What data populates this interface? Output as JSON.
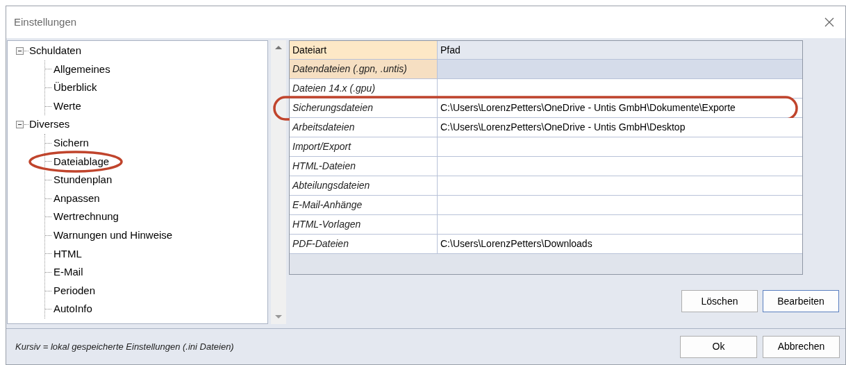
{
  "window": {
    "title": "Einstellungen"
  },
  "tree": [
    {
      "label": "Schuldaten",
      "expanded": true,
      "children": [
        {
          "label": "Allgemeines",
          "circled": false
        },
        {
          "label": "Überblick",
          "circled": false
        },
        {
          "label": "Werte",
          "circled": false
        }
      ]
    },
    {
      "label": "Diverses",
      "expanded": true,
      "children": [
        {
          "label": "Sichern",
          "circled": false
        },
        {
          "label": "Dateiablage",
          "circled": true
        },
        {
          "label": "Stundenplan",
          "circled": false
        },
        {
          "label": "Anpassen",
          "circled": false
        },
        {
          "label": "Wertrechnung",
          "circled": false
        },
        {
          "label": "Warnungen und Hinweise",
          "circled": false
        },
        {
          "label": "HTML",
          "circled": false
        },
        {
          "label": "E-Mail",
          "circled": false
        },
        {
          "label": "Perioden",
          "circled": false
        },
        {
          "label": "AutoInfo",
          "circled": false
        }
      ]
    }
  ],
  "table": {
    "columns": [
      "Dateiart",
      "Pfad"
    ],
    "rows": [
      {
        "type": "Datendateien (.gpn, .untis)",
        "path": "",
        "selected": true,
        "circled": false
      },
      {
        "type": "Dateien 14.x (.gpu)",
        "path": "",
        "selected": false,
        "circled": false
      },
      {
        "type": "Sicherungsdateien",
        "path": "C:\\Users\\LorenzPetters\\OneDrive - Untis GmbH\\Dokumente\\Exporte",
        "selected": false,
        "circled": true
      },
      {
        "type": "Arbeitsdateien",
        "path": "C:\\Users\\LorenzPetters\\OneDrive - Untis GmbH\\Desktop",
        "selected": false,
        "circled": false
      },
      {
        "type": "Import/Export",
        "path": "",
        "selected": false,
        "circled": false
      },
      {
        "type": "HTML-Dateien",
        "path": "",
        "selected": false,
        "circled": false
      },
      {
        "type": "Abteilungsdateien",
        "path": "",
        "selected": false,
        "circled": false
      },
      {
        "type": "E-Mail-Anhänge",
        "path": "",
        "selected": false,
        "circled": false
      },
      {
        "type": "HTML-Vorlagen",
        "path": "",
        "selected": false,
        "circled": false
      },
      {
        "type": "PDF-Dateien",
        "path": "C:\\Users\\LorenzPetters\\Downloads",
        "selected": false,
        "circled": false
      }
    ]
  },
  "table_buttons": [
    "Löschen",
    "Bearbeiten"
  ],
  "footer_note": "Kursiv = lokal gespeicherte Einstellungen (.ini Dateien)",
  "dialog_buttons": [
    "Ok",
    "Abbrechen"
  ]
}
